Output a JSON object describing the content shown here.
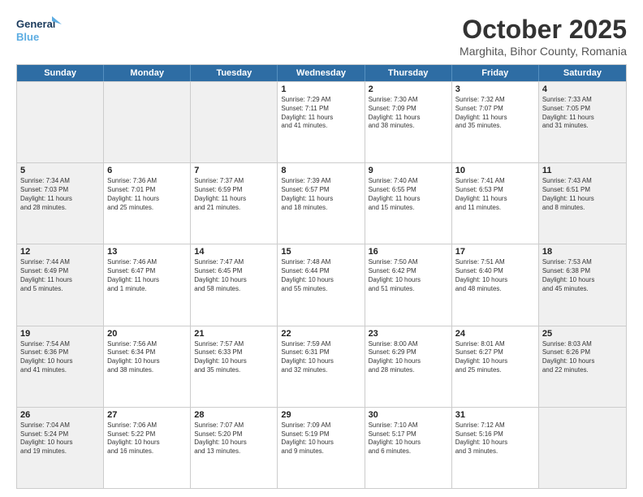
{
  "logo": {
    "line1": "General",
    "line2": "Blue"
  },
  "title": "October 2025",
  "location": "Marghita, Bihor County, Romania",
  "days_of_week": [
    "Sunday",
    "Monday",
    "Tuesday",
    "Wednesday",
    "Thursday",
    "Friday",
    "Saturday"
  ],
  "weeks": [
    [
      {
        "day": "",
        "info": "",
        "shaded": true
      },
      {
        "day": "",
        "info": "",
        "shaded": true
      },
      {
        "day": "",
        "info": "",
        "shaded": true
      },
      {
        "day": "1",
        "info": "Sunrise: 7:29 AM\nSunset: 7:11 PM\nDaylight: 11 hours\nand 41 minutes.",
        "shaded": false
      },
      {
        "day": "2",
        "info": "Sunrise: 7:30 AM\nSunset: 7:09 PM\nDaylight: 11 hours\nand 38 minutes.",
        "shaded": false
      },
      {
        "day": "3",
        "info": "Sunrise: 7:32 AM\nSunset: 7:07 PM\nDaylight: 11 hours\nand 35 minutes.",
        "shaded": false
      },
      {
        "day": "4",
        "info": "Sunrise: 7:33 AM\nSunset: 7:05 PM\nDaylight: 11 hours\nand 31 minutes.",
        "shaded": true
      }
    ],
    [
      {
        "day": "5",
        "info": "Sunrise: 7:34 AM\nSunset: 7:03 PM\nDaylight: 11 hours\nand 28 minutes.",
        "shaded": true
      },
      {
        "day": "6",
        "info": "Sunrise: 7:36 AM\nSunset: 7:01 PM\nDaylight: 11 hours\nand 25 minutes.",
        "shaded": false
      },
      {
        "day": "7",
        "info": "Sunrise: 7:37 AM\nSunset: 6:59 PM\nDaylight: 11 hours\nand 21 minutes.",
        "shaded": false
      },
      {
        "day": "8",
        "info": "Sunrise: 7:39 AM\nSunset: 6:57 PM\nDaylight: 11 hours\nand 18 minutes.",
        "shaded": false
      },
      {
        "day": "9",
        "info": "Sunrise: 7:40 AM\nSunset: 6:55 PM\nDaylight: 11 hours\nand 15 minutes.",
        "shaded": false
      },
      {
        "day": "10",
        "info": "Sunrise: 7:41 AM\nSunset: 6:53 PM\nDaylight: 11 hours\nand 11 minutes.",
        "shaded": false
      },
      {
        "day": "11",
        "info": "Sunrise: 7:43 AM\nSunset: 6:51 PM\nDaylight: 11 hours\nand 8 minutes.",
        "shaded": true
      }
    ],
    [
      {
        "day": "12",
        "info": "Sunrise: 7:44 AM\nSunset: 6:49 PM\nDaylight: 11 hours\nand 5 minutes.",
        "shaded": true
      },
      {
        "day": "13",
        "info": "Sunrise: 7:46 AM\nSunset: 6:47 PM\nDaylight: 11 hours\nand 1 minute.",
        "shaded": false
      },
      {
        "day": "14",
        "info": "Sunrise: 7:47 AM\nSunset: 6:45 PM\nDaylight: 10 hours\nand 58 minutes.",
        "shaded": false
      },
      {
        "day": "15",
        "info": "Sunrise: 7:48 AM\nSunset: 6:44 PM\nDaylight: 10 hours\nand 55 minutes.",
        "shaded": false
      },
      {
        "day": "16",
        "info": "Sunrise: 7:50 AM\nSunset: 6:42 PM\nDaylight: 10 hours\nand 51 minutes.",
        "shaded": false
      },
      {
        "day": "17",
        "info": "Sunrise: 7:51 AM\nSunset: 6:40 PM\nDaylight: 10 hours\nand 48 minutes.",
        "shaded": false
      },
      {
        "day": "18",
        "info": "Sunrise: 7:53 AM\nSunset: 6:38 PM\nDaylight: 10 hours\nand 45 minutes.",
        "shaded": true
      }
    ],
    [
      {
        "day": "19",
        "info": "Sunrise: 7:54 AM\nSunset: 6:36 PM\nDaylight: 10 hours\nand 41 minutes.",
        "shaded": true
      },
      {
        "day": "20",
        "info": "Sunrise: 7:56 AM\nSunset: 6:34 PM\nDaylight: 10 hours\nand 38 minutes.",
        "shaded": false
      },
      {
        "day": "21",
        "info": "Sunrise: 7:57 AM\nSunset: 6:33 PM\nDaylight: 10 hours\nand 35 minutes.",
        "shaded": false
      },
      {
        "day": "22",
        "info": "Sunrise: 7:59 AM\nSunset: 6:31 PM\nDaylight: 10 hours\nand 32 minutes.",
        "shaded": false
      },
      {
        "day": "23",
        "info": "Sunrise: 8:00 AM\nSunset: 6:29 PM\nDaylight: 10 hours\nand 28 minutes.",
        "shaded": false
      },
      {
        "day": "24",
        "info": "Sunrise: 8:01 AM\nSunset: 6:27 PM\nDaylight: 10 hours\nand 25 minutes.",
        "shaded": false
      },
      {
        "day": "25",
        "info": "Sunrise: 8:03 AM\nSunset: 6:26 PM\nDaylight: 10 hours\nand 22 minutes.",
        "shaded": true
      }
    ],
    [
      {
        "day": "26",
        "info": "Sunrise: 7:04 AM\nSunset: 5:24 PM\nDaylight: 10 hours\nand 19 minutes.",
        "shaded": true
      },
      {
        "day": "27",
        "info": "Sunrise: 7:06 AM\nSunset: 5:22 PM\nDaylight: 10 hours\nand 16 minutes.",
        "shaded": false
      },
      {
        "day": "28",
        "info": "Sunrise: 7:07 AM\nSunset: 5:20 PM\nDaylight: 10 hours\nand 13 minutes.",
        "shaded": false
      },
      {
        "day": "29",
        "info": "Sunrise: 7:09 AM\nSunset: 5:19 PM\nDaylight: 10 hours\nand 9 minutes.",
        "shaded": false
      },
      {
        "day": "30",
        "info": "Sunrise: 7:10 AM\nSunset: 5:17 PM\nDaylight: 10 hours\nand 6 minutes.",
        "shaded": false
      },
      {
        "day": "31",
        "info": "Sunrise: 7:12 AM\nSunset: 5:16 PM\nDaylight: 10 hours\nand 3 minutes.",
        "shaded": false
      },
      {
        "day": "",
        "info": "",
        "shaded": true
      }
    ]
  ]
}
